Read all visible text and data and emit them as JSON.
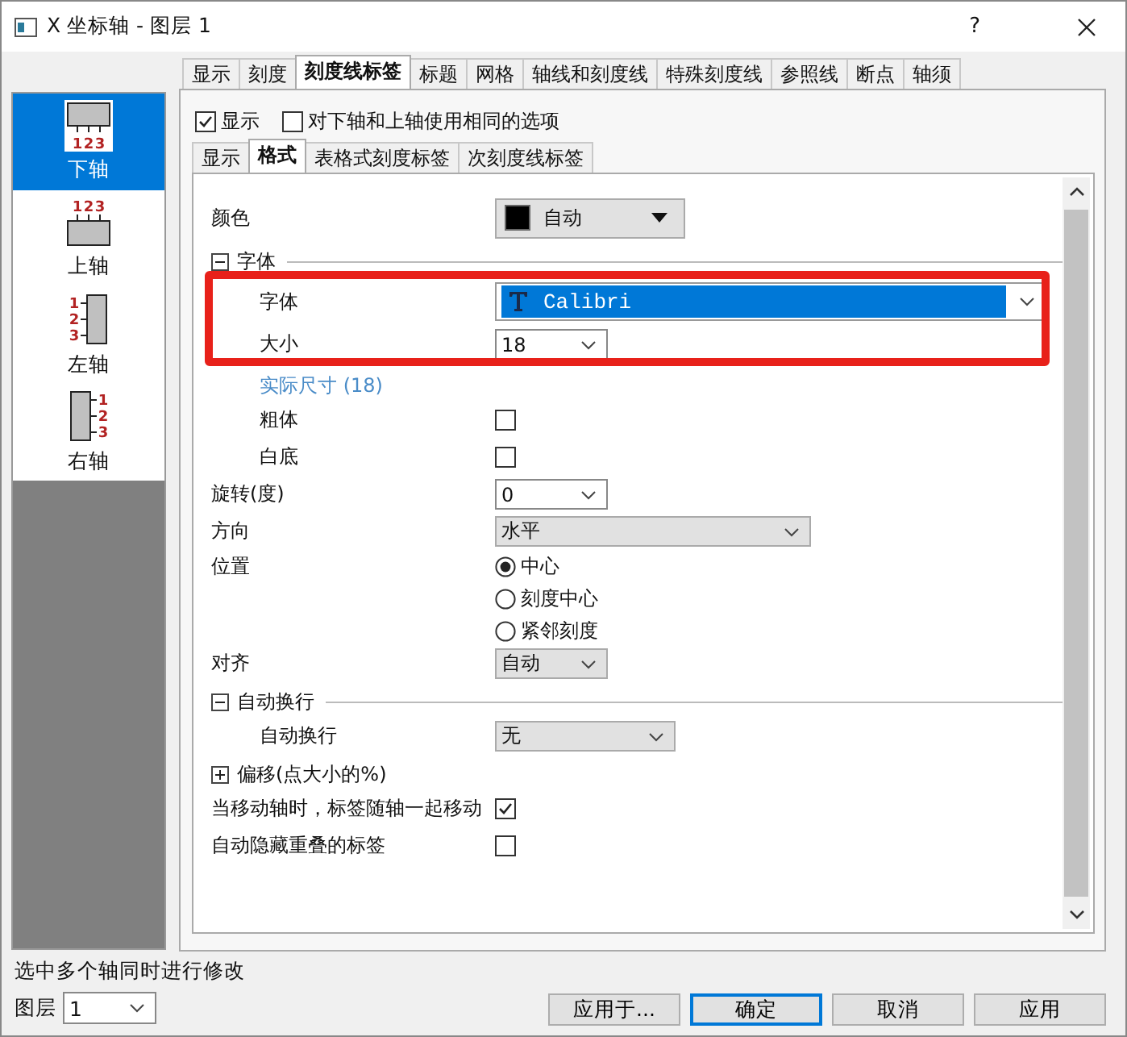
{
  "window": {
    "title": "X 坐标轴 - 图层 1",
    "help": "?"
  },
  "tabs": [
    {
      "label": "显示",
      "selected": false
    },
    {
      "label": "刻度",
      "selected": false
    },
    {
      "label": "刻度线标签",
      "selected": true
    },
    {
      "label": "标题",
      "selected": false
    },
    {
      "label": "网格",
      "selected": false
    },
    {
      "label": "轴线和刻度线",
      "selected": false
    },
    {
      "label": "特殊刻度线",
      "selected": false
    },
    {
      "label": "参照线",
      "selected": false
    },
    {
      "label": "断点",
      "selected": false
    },
    {
      "label": "轴须",
      "selected": false
    }
  ],
  "sidebar": {
    "items": [
      {
        "label": "下轴",
        "kind": "bottom",
        "selected": true,
        "tick_labels": [
          "1",
          "2",
          "3"
        ]
      },
      {
        "label": "上轴",
        "kind": "top",
        "selected": false,
        "tick_labels": [
          "1",
          "2",
          "3"
        ]
      },
      {
        "label": "左轴",
        "kind": "left",
        "selected": false,
        "tick_labels": [
          "1",
          "2",
          "3"
        ]
      },
      {
        "label": "右轴",
        "kind": "right",
        "selected": false,
        "tick_labels": [
          "1",
          "2",
          "3"
        ]
      }
    ]
  },
  "options": [
    {
      "label": "显示",
      "checked": true
    },
    {
      "label": "对下轴和上轴使用相同的选项",
      "checked": false
    }
  ],
  "subtabs": [
    {
      "label": "显示",
      "selected": false
    },
    {
      "label": "格式",
      "selected": true
    },
    {
      "label": "表格式刻度标签",
      "selected": false
    },
    {
      "label": "次刻度线标签",
      "selected": false
    }
  ],
  "properties": [
    {
      "kind": "color",
      "label": "颜色",
      "value": "自动",
      "color": "#000000"
    },
    {
      "kind": "group",
      "label": "字体",
      "expanded": true,
      "children": [
        {
          "kind": "font",
          "label": "字体",
          "value": "Calibri"
        },
        {
          "kind": "combo",
          "label": "大小",
          "value": "18"
        },
        {
          "kind": "link",
          "label": "实际尺寸 (18)"
        },
        {
          "kind": "checkbox",
          "label": "粗体",
          "checked": false
        },
        {
          "kind": "checkbox",
          "label": "白底",
          "checked": false
        }
      ]
    },
    {
      "kind": "combo",
      "label": "旋转(度)",
      "value": "0"
    },
    {
      "kind": "dropdown",
      "label": "方向",
      "value": "水平"
    },
    {
      "kind": "radio",
      "label": "位置",
      "options": [
        {
          "label": "中心",
          "selected": true
        },
        {
          "label": "刻度中心",
          "selected": false
        },
        {
          "label": "紧邻刻度",
          "selected": false
        }
      ]
    },
    {
      "kind": "dropdown",
      "label": "对齐",
      "value": "自动"
    },
    {
      "kind": "group",
      "label": "自动换行",
      "expanded": true,
      "children": [
        {
          "kind": "dropdown",
          "label": "自动换行",
          "value": "无"
        }
      ]
    },
    {
      "kind": "group",
      "label": "偏移(点大小的%)",
      "expanded": false
    },
    {
      "kind": "checkbox",
      "label": "当移动轴时，标签随轴一起移动",
      "checked": true
    },
    {
      "kind": "checkbox",
      "label": "自动隐藏重叠的标签",
      "checked": false
    }
  ],
  "footer": {
    "hint": "选中多个轴同时进行修改",
    "layer_label": "图层",
    "layer_value": "1",
    "buttons": [
      {
        "label": "应用于...",
        "default": false
      },
      {
        "label": "确定",
        "default": true
      },
      {
        "label": "取消",
        "default": false
      },
      {
        "label": "应用",
        "default": false
      }
    ]
  }
}
